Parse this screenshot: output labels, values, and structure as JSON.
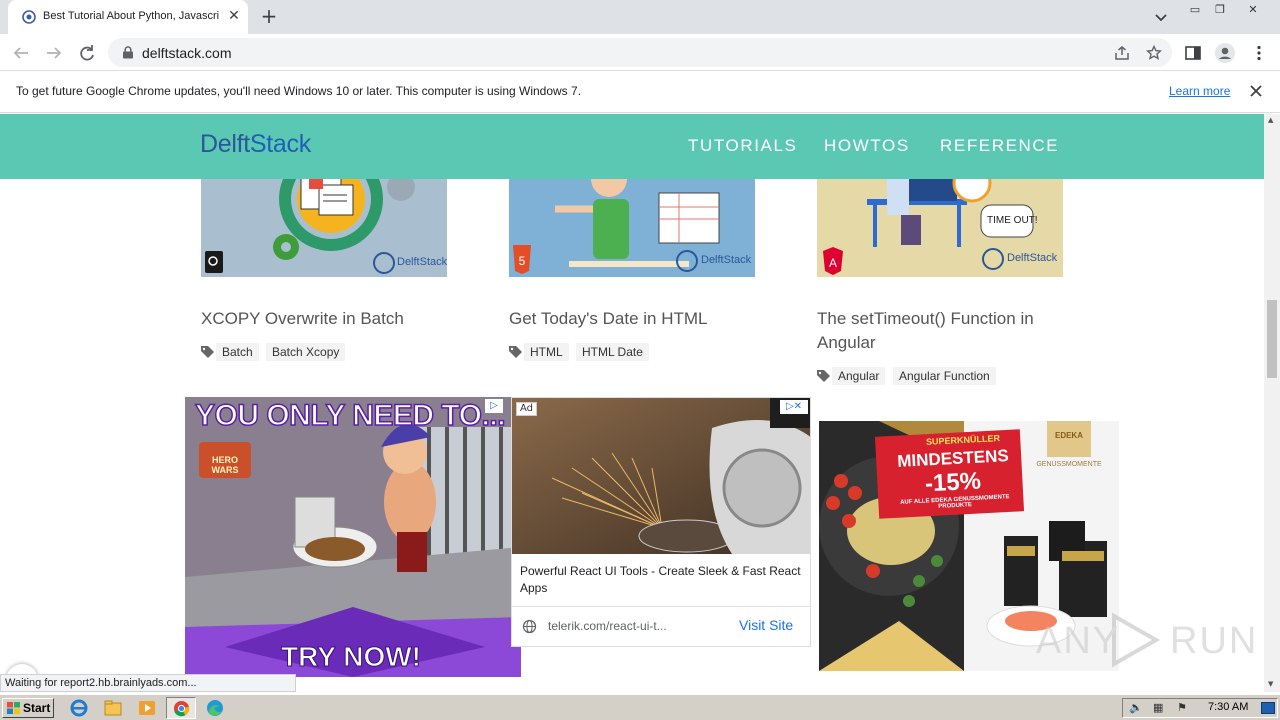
{
  "browser": {
    "tab_title": "Best Tutorial About Python, Javascript",
    "url": "delftstack.com",
    "info_bar": {
      "message": "To get future Google Chrome updates, you'll need Windows 10 or later. This computer is using Windows 7.",
      "link": "Learn more"
    },
    "status": "Waiting for report2.hb.brainlyads.com..."
  },
  "site": {
    "logo_part1": "Delft",
    "logo_part2": "Stack",
    "nav": [
      "TUTORIALS",
      "HOWTOS",
      "REFERENCE"
    ]
  },
  "posts": [
    {
      "title": "XCOPY Overwrite in Batch",
      "tags": [
        "Batch",
        "Batch Xcopy"
      ],
      "badge": "DelftStack"
    },
    {
      "title": "Get Today's Date in HTML",
      "tags": [
        "HTML",
        "HTML Date"
      ],
      "badge": "DelftStack"
    },
    {
      "title": "The setTimeout() Function in Angular",
      "tags": [
        "Angular",
        "Angular Function"
      ],
      "badge": "DelftStack",
      "thumb_text": "TIME OUT!"
    }
  ],
  "ads": {
    "hero_wars": {
      "headline": "YOU ONLY NEED TO...",
      "cta": "TRY NOW!",
      "brand": "HERO WARS"
    },
    "telerik": {
      "label": "Ad",
      "headline": "Powerful React UI Tools - Create Sleek & Fast React Apps",
      "domain": "telerik.com/react-ui-t...",
      "cta": "Visit Site"
    },
    "edeka": {
      "banner_top": "SUPERKNÜLLER",
      "banner_main": "MINDESTENS",
      "banner_percent": "-15%",
      "banner_sub": "AUF ALLE EDEKA GENUSSMOMENTE PRODUKTE",
      "brand": "EDEKA",
      "brand_sub": "GENUSSMOMENTE"
    }
  },
  "watermark": "ANY RUN",
  "taskbar": {
    "start": "Start",
    "clock": "7:30 AM"
  },
  "colors": {
    "site_header": "#5bc8b4",
    "logo": "#2b579a",
    "link": "#1a73e8"
  }
}
